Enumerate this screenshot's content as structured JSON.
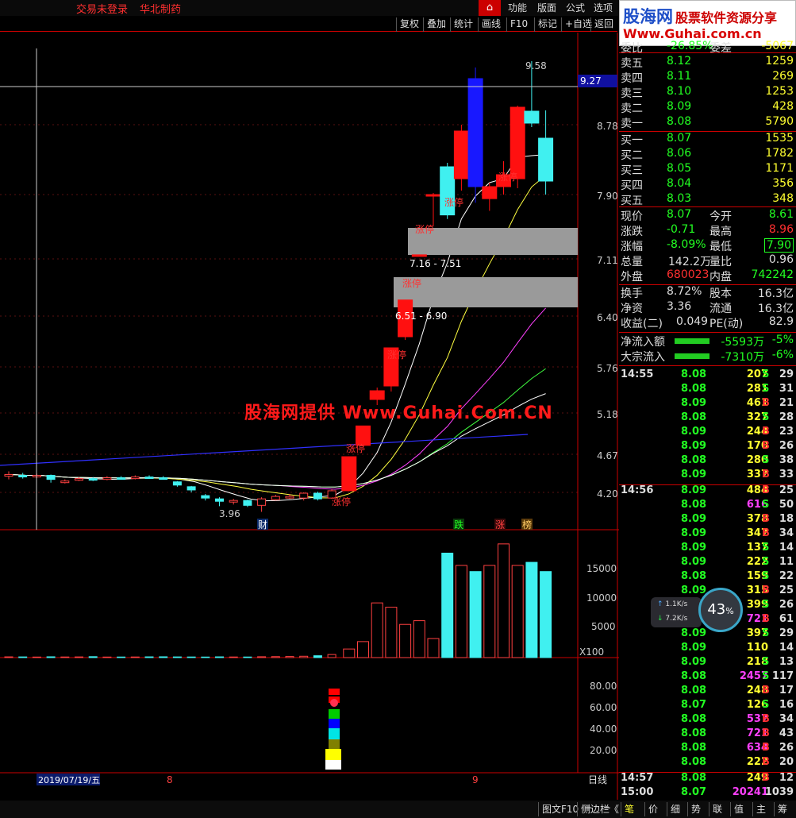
{
  "status_bar": {
    "login": "交易未登录",
    "stock_name": "华北制药"
  },
  "menu": [
    "功能",
    "版面",
    "公式",
    "选项"
  ],
  "logo": {
    "brand": "股海网",
    "slogan": "股票软件资源分享",
    "url": "Www.Guhai.com.cn"
  },
  "toolbar": [
    "复权",
    "叠加",
    "统计",
    "画线",
    "F10",
    "标记",
    "+自选",
    "返回"
  ],
  "price_axis": [
    "8.78",
    "7.90",
    "7.11",
    "6.40",
    "5.76",
    "5.18",
    "4.67",
    "4.20"
  ],
  "crosshair_price": "9.27",
  "annotations": {
    "high": "9.58",
    "low": "3.96",
    "gap1": "7.16 - 7.51",
    "gap2": "6.51 - 6.90",
    "limit_up": "涨停",
    "badges": [
      "财",
      "跌",
      "涨",
      "榜"
    ]
  },
  "watermark": "股海网提供 Www.Guhai.Com.CN",
  "volume_axis": [
    "15000",
    "10000",
    "5000"
  ],
  "volume_unit": "X100",
  "indicator_axis": [
    "80.00",
    "60.00",
    "40.00",
    "20.00"
  ],
  "date_axis": {
    "cursor_date": "2019/07/19/五",
    "months": [
      "8",
      "9"
    ],
    "period": "日线"
  },
  "quote": {
    "top_label": "委比",
    "top_value": "-26.85%",
    "top_label2": "委差",
    "top_value2": "-5067",
    "asks": [
      {
        "label": "卖五",
        "price": "8.12",
        "vol": "1259"
      },
      {
        "label": "卖四",
        "price": "8.11",
        "vol": "269"
      },
      {
        "label": "卖三",
        "price": "8.10",
        "vol": "1253"
      },
      {
        "label": "卖二",
        "price": "8.09",
        "vol": "428"
      },
      {
        "label": "卖一",
        "price": "8.08",
        "vol": "5790"
      }
    ],
    "bids": [
      {
        "label": "买一",
        "price": "8.07",
        "vol": "1535"
      },
      {
        "label": "买二",
        "price": "8.06",
        "vol": "1782"
      },
      {
        "label": "买三",
        "price": "8.05",
        "vol": "1171"
      },
      {
        "label": "买四",
        "price": "8.04",
        "vol": "356"
      },
      {
        "label": "买五",
        "price": "8.03",
        "vol": "348"
      }
    ],
    "stats": [
      {
        "l1": "现价",
        "v1": "8.07",
        "l2": "今开",
        "v2": "8.61"
      },
      {
        "l1": "涨跌",
        "v1": "-0.71",
        "l2": "最高",
        "v2": "8.96"
      },
      {
        "l1": "涨幅",
        "v1": "-8.09%",
        "l2": "最低",
        "v2": "7.90"
      },
      {
        "l1": "总量",
        "v1": "142.2万",
        "l2": "量比",
        "v2": "0.96"
      },
      {
        "l1": "外盘",
        "v1": "680023",
        "l2": "内盘",
        "v2": "742242"
      },
      {
        "l1": "换手",
        "v1": "8.72%",
        "l2": "股本",
        "v2": "16.3亿"
      },
      {
        "l1": "净资",
        "v1": "3.36",
        "l2": "流通",
        "v2": "16.3亿"
      },
      {
        "l1": "收益(二)",
        "v1": "0.049",
        "l2": "PE(动)",
        "v2": "82.9"
      }
    ],
    "flows": [
      {
        "label": "净流入额",
        "value": "-5593万",
        "pct": "-5%"
      },
      {
        "label": "大宗流入",
        "value": "-7310万",
        "pct": "-6%"
      }
    ]
  },
  "ticks": [
    {
      "t": "14:55",
      "p": "8.08",
      "v": "207",
      "bs": "S",
      "n": "29"
    },
    {
      "t": "",
      "p": "8.08",
      "v": "281",
      "bs": "S",
      "n": "31"
    },
    {
      "t": "",
      "p": "8.09",
      "v": "461",
      "bs": "B",
      "n": "21"
    },
    {
      "t": "",
      "p": "8.08",
      "v": "327",
      "bs": "S",
      "n": "28"
    },
    {
      "t": "",
      "p": "8.09",
      "v": "244",
      "bs": "B",
      "n": "23"
    },
    {
      "t": "",
      "p": "8.09",
      "v": "170",
      "bs": "B",
      "n": "26"
    },
    {
      "t": "",
      "p": "8.08",
      "v": "280",
      "bs": "S",
      "n": "38"
    },
    {
      "t": "",
      "p": "8.09",
      "v": "337",
      "bs": "B",
      "n": "33"
    },
    {
      "t": "14:56",
      "p": "8.09",
      "v": "484",
      "bs": "B",
      "n": "25"
    },
    {
      "t": "",
      "p": "8.08",
      "v": "616",
      "bs": "S",
      "n": "50"
    },
    {
      "t": "",
      "p": "8.09",
      "v": "378",
      "bs": "B",
      "n": "18"
    },
    {
      "t": "",
      "p": "8.09",
      "v": "347",
      "bs": "B",
      "n": "34"
    },
    {
      "t": "",
      "p": "8.09",
      "v": "137",
      "bs": "S",
      "n": "14"
    },
    {
      "t": "",
      "p": "8.09",
      "v": "222",
      "bs": "S",
      "n": "11"
    },
    {
      "t": "",
      "p": "8.08",
      "v": "159",
      "bs": "S",
      "n": "22"
    },
    {
      "t": "",
      "p": "8.09",
      "v": "315",
      "bs": "B",
      "n": "25"
    },
    {
      "t": "",
      "p": "8.09",
      "v": "399",
      "bs": "S",
      "n": "26"
    },
    {
      "t": "",
      "p": "8.09",
      "v": "721",
      "bs": "B",
      "n": "61"
    },
    {
      "t": "",
      "p": "8.09",
      "v": "397",
      "bs": "S",
      "n": "29"
    },
    {
      "t": "",
      "p": "8.09",
      "v": "110",
      "bs": "",
      "n": "14"
    },
    {
      "t": "",
      "p": "8.09",
      "v": "218",
      "bs": "S",
      "n": "13"
    },
    {
      "t": "",
      "p": "8.08",
      "v": "2457",
      "bs": "S",
      "n": "117"
    },
    {
      "t": "",
      "p": "8.08",
      "v": "248",
      "bs": "B",
      "n": "17"
    },
    {
      "t": "",
      "p": "8.07",
      "v": "126",
      "bs": "S",
      "n": "16"
    },
    {
      "t": "",
      "p": "8.08",
      "v": "537",
      "bs": "B",
      "n": "34"
    },
    {
      "t": "",
      "p": "8.08",
      "v": "721",
      "bs": "B",
      "n": "43"
    },
    {
      "t": "",
      "p": "8.08",
      "v": "634",
      "bs": "B",
      "n": "26"
    },
    {
      "t": "",
      "p": "8.08",
      "v": "222",
      "bs": "B",
      "n": "20"
    },
    {
      "t": "14:57",
      "p": "8.08",
      "v": "249",
      "bs": "B",
      "n": "12"
    },
    {
      "t": "15:00",
      "p": "8.07",
      "v": "20241",
      "bs": "",
      "n": "1039"
    }
  ],
  "speed_widget": {
    "up": "1.1K/s",
    "down": "7.2K/s",
    "pct": "43"
  },
  "bottom": {
    "left_buttons": [
      "+",
      "−"
    ],
    "tabs": [
      "图文F10",
      "侧边栏《",
      "笔",
      "价",
      "细",
      "势",
      "联",
      "值",
      "主",
      "筹"
    ]
  },
  "chart_data": {
    "type": "candlestick",
    "y_range": [
      3.8,
      9.8
    ],
    "candles": [
      {
        "o": 4.4,
        "c": 4.42,
        "h": 4.46,
        "l": 4.36
      },
      {
        "o": 4.41,
        "c": 4.4,
        "h": 4.44,
        "l": 4.37
      },
      {
        "o": 4.4,
        "c": 4.41,
        "h": 4.43,
        "l": 4.38
      },
      {
        "o": 4.41,
        "c": 4.36,
        "h": 4.42,
        "l": 4.32
      },
      {
        "o": 4.33,
        "c": 4.34,
        "h": 4.36,
        "l": 4.31
      },
      {
        "o": 4.35,
        "c": 4.37,
        "h": 4.39,
        "l": 4.34
      },
      {
        "o": 4.37,
        "c": 4.36,
        "h": 4.39,
        "l": 4.34
      },
      {
        "o": 4.36,
        "c": 4.38,
        "h": 4.4,
        "l": 4.35
      },
      {
        "o": 4.38,
        "c": 4.37,
        "h": 4.4,
        "l": 4.36
      },
      {
        "o": 4.37,
        "c": 4.39,
        "h": 4.41,
        "l": 4.36
      },
      {
        "o": 4.39,
        "c": 4.38,
        "h": 4.41,
        "l": 4.37
      },
      {
        "o": 4.38,
        "c": 4.37,
        "h": 4.4,
        "l": 4.36
      },
      {
        "o": 4.33,
        "c": 4.29,
        "h": 4.34,
        "l": 4.27
      },
      {
        "o": 4.27,
        "c": 4.23,
        "h": 4.28,
        "l": 4.2
      },
      {
        "o": 4.16,
        "c": 4.13,
        "h": 4.18,
        "l": 4.1
      },
      {
        "o": 4.12,
        "c": 4.09,
        "h": 4.14,
        "l": 4.03
      },
      {
        "o": 4.09,
        "c": 4.1,
        "h": 4.12,
        "l": 4.05
      },
      {
        "o": 4.1,
        "c": 4.04,
        "h": 4.11,
        "l": 4.02
      },
      {
        "o": 4.04,
        "c": 4.12,
        "h": 4.14,
        "l": 3.96
      },
      {
        "o": 4.11,
        "c": 4.15,
        "h": 4.17,
        "l": 4.1
      },
      {
        "o": 4.14,
        "c": 4.15,
        "h": 4.18,
        "l": 4.12
      },
      {
        "o": 4.13,
        "c": 4.19,
        "h": 4.2,
        "l": 4.1
      },
      {
        "o": 4.19,
        "c": 4.12,
        "h": 4.21,
        "l": 4.1
      },
      {
        "o": 4.13,
        "c": 4.22,
        "h": 4.24,
        "l": 4.12
      },
      {
        "o": 4.22,
        "c": 4.64,
        "h": 4.64,
        "l": 4.22
      },
      {
        "o": 4.78,
        "c": 5.02,
        "h": 5.02,
        "l": 4.76
      },
      {
        "o": 5.35,
        "c": 5.46,
        "h": 5.5,
        "l": 5.28
      },
      {
        "o": 5.52,
        "c": 6.0,
        "h": 6.0,
        "l": 5.45
      },
      {
        "o": 6.14,
        "c": 6.6,
        "h": 6.6,
        "l": 6.1
      },
      {
        "o": 7.16,
        "c": 7.16,
        "h": 7.16,
        "l": 7.16
      },
      {
        "o": 7.9,
        "c": 7.9,
        "h": 7.92,
        "l": 7.52
      },
      {
        "o": 8.25,
        "c": 7.65,
        "h": 8.3,
        "l": 7.6
      },
      {
        "o": 8.1,
        "c": 8.7,
        "h": 8.78,
        "l": 7.95
      },
      {
        "o": 9.36,
        "c": 8.0,
        "h": 9.5,
        "l": 7.8
      },
      {
        "o": 7.85,
        "c": 8.0,
        "h": 8.05,
        "l": 7.7
      },
      {
        "o": 8.0,
        "c": 8.15,
        "h": 8.32,
        "l": 7.9
      },
      {
        "o": 8.1,
        "c": 9.0,
        "h": 9.02,
        "l": 7.98
      },
      {
        "o": 8.95,
        "c": 8.8,
        "h": 9.58,
        "l": 8.75
      },
      {
        "o": 8.61,
        "c": 8.07,
        "h": 8.96,
        "l": 7.9
      }
    ],
    "volume": [
      120,
      110,
      90,
      130,
      100,
      110,
      150,
      90,
      95,
      100,
      120,
      130,
      110,
      100,
      90,
      120,
      100,
      95,
      140,
      160,
      180,
      220,
      300,
      500,
      1400,
      2600,
      8900,
      8200,
      5400,
      6000,
      3100,
      17000,
      15000,
      14000,
      15000,
      18500,
      15000,
      15500,
      14000
    ],
    "volume_range": [
      0,
      19000
    ]
  }
}
